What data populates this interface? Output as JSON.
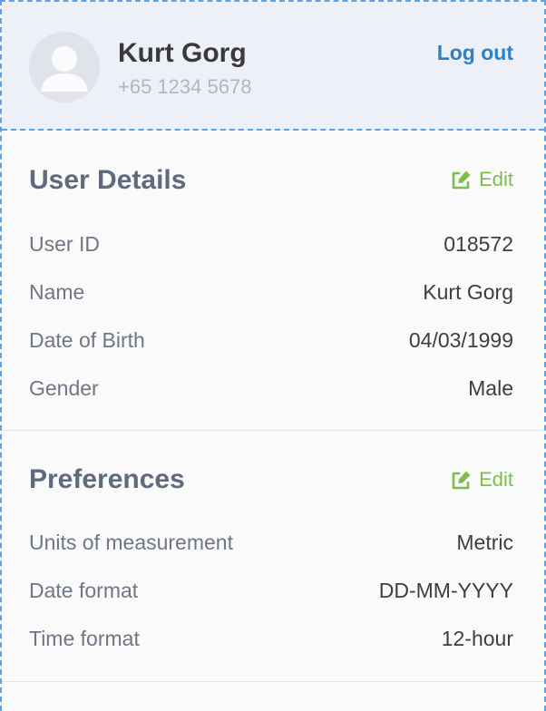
{
  "header": {
    "name": "Kurt Gorg",
    "phone": "+65 1234 5678",
    "logout_label": "Log out",
    "avatar_icon": "user-avatar-icon"
  },
  "user_details": {
    "title": "User Details",
    "edit_label": "Edit",
    "edit_icon": "edit-icon",
    "rows": [
      {
        "label": "User ID",
        "value": "018572"
      },
      {
        "label": "Name",
        "value": "Kurt Gorg"
      },
      {
        "label": "Date of Birth",
        "value": "04/03/1999"
      },
      {
        "label": "Gender",
        "value": "Male"
      }
    ]
  },
  "preferences": {
    "title": "Preferences",
    "edit_label": "Edit",
    "edit_icon": "edit-icon",
    "rows": [
      {
        "label": "Units of measurement",
        "value": "Metric"
      },
      {
        "label": "Date format",
        "value": "DD-MM-YYYY"
      },
      {
        "label": "Time format",
        "value": "12-hour"
      }
    ]
  },
  "colors": {
    "accent_blue": "#2f7fc4",
    "edit_green": "#7cc04a",
    "header_bg": "#eef0f7",
    "title_gray": "#5f6a7f"
  }
}
